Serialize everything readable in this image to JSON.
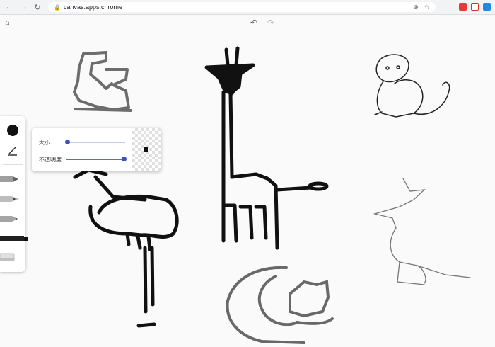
{
  "browser": {
    "url": "canvas.apps.chrome",
    "extensions": [
      {
        "name": "extension-1-icon",
        "color": "#e53935"
      },
      {
        "name": "gmail-icon",
        "color": "#d93025"
      },
      {
        "name": "extension-3-icon",
        "color": "#1e88e5"
      }
    ]
  },
  "toolbar": {
    "home_icon": "home-icon",
    "undo_icon": "undo-icon",
    "redo_icon": "redo-icon"
  },
  "tools": {
    "current_color": "#111111",
    "items": [
      "pen-tool",
      "marker-tool",
      "pencil-tool",
      "chalk-tool",
      "eraser-tool"
    ]
  },
  "size_panel": {
    "size_label": "大小",
    "opacity_label": "不透明度",
    "size_value_fraction": 0.02,
    "opacity_value_fraction": 1.0
  }
}
